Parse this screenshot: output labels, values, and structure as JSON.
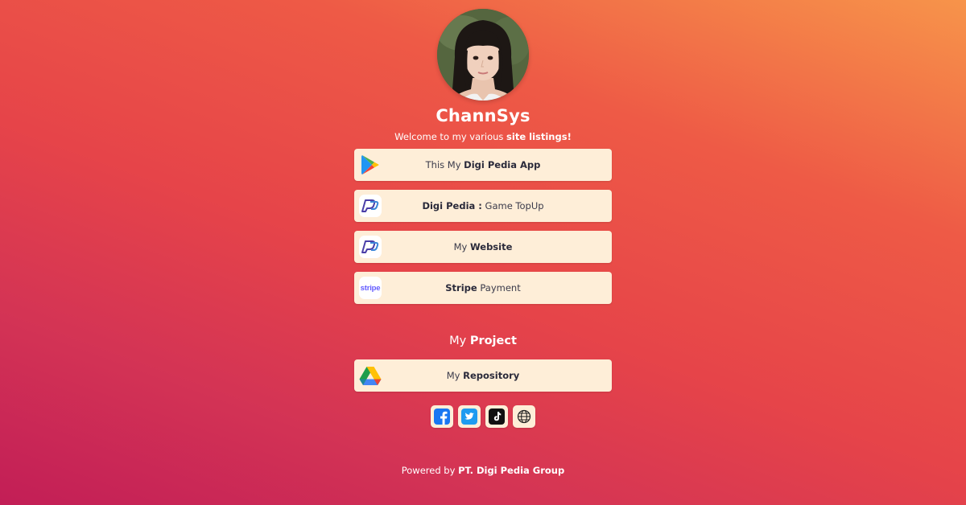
{
  "profile": {
    "name": "ChannSys",
    "tagline_prefix": "Welcome to my various ",
    "tagline_bold": "site listings!"
  },
  "links": [
    {
      "icon": "google-play-icon",
      "pre": "This My ",
      "bold": "Digi Pedia App",
      "post": ""
    },
    {
      "icon": "digi-pedia-logo-icon",
      "pre": "",
      "bold": "Digi Pedia :",
      "post": " Game TopUp"
    },
    {
      "icon": "digi-pedia-logo-icon",
      "pre": "My ",
      "bold": "Website",
      "post": ""
    },
    {
      "icon": "stripe-icon",
      "icon_text": "stripe",
      "pre": "",
      "bold": "Stripe",
      "post": " Payment"
    }
  ],
  "project": {
    "title_prefix": "My ",
    "title_bold": "Project",
    "link": {
      "icon": "google-drive-icon",
      "pre": "My ",
      "bold": "Repository",
      "post": ""
    }
  },
  "socials": [
    "facebook-icon",
    "twitter-icon",
    "tiktok-icon",
    "globe-icon"
  ],
  "footer": {
    "prefix": "Powered by ",
    "bold": "PT. Digi Pedia Group"
  },
  "colors": {
    "button_bg": "#feeed8",
    "gradient_top": "#f7944a",
    "gradient_bottom": "#c21e56"
  }
}
